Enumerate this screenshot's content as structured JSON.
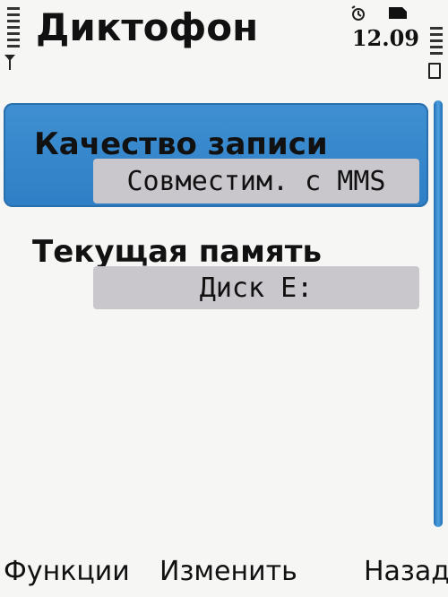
{
  "header": {
    "title": "Диктофон",
    "time": "12.09"
  },
  "status": {
    "signal_icon": "signal-strength-icon",
    "antenna_icon": "antenna-icon",
    "alarm_icon": "alarm-icon",
    "memory_card_icon": "memory-card-icon",
    "battery_icon": "battery-icon"
  },
  "settings": {
    "items": [
      {
        "label": "Качество записи",
        "value": "Совместим. с MMS",
        "selected": true
      },
      {
        "label": "Текущая память",
        "value": "Диск E:",
        "selected": false
      }
    ]
  },
  "softkeys": {
    "left": "Функции",
    "middle": "Изменить",
    "right": "Назад"
  },
  "colors": {
    "selection": "#3a8ad0",
    "value_box": "#c9c6cc",
    "background": "#f6f6f5"
  }
}
